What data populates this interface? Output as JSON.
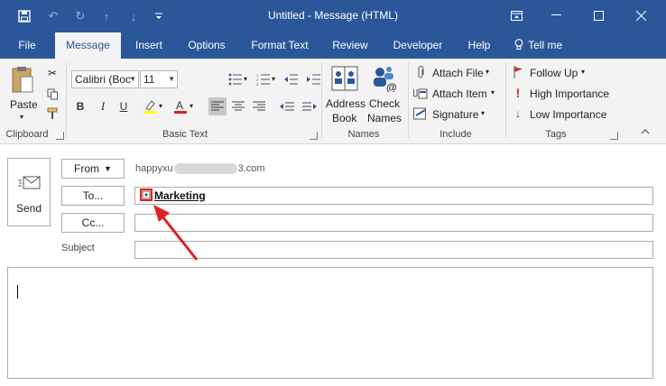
{
  "window": {
    "title": "Untitled  -  Message (HTML)",
    "tell_me": "Tell me"
  },
  "tabs": [
    "File",
    "Message",
    "Insert",
    "Options",
    "Format Text",
    "Review",
    "Developer",
    "Help"
  ],
  "ribbon": {
    "clipboard": {
      "paste": "Paste",
      "label": "Clipboard"
    },
    "basic_text": {
      "font_name": "Calibri (Boc",
      "font_size": "11",
      "label": "Basic Text"
    },
    "names": {
      "address_book": [
        "Address",
        "Book"
      ],
      "check_names": [
        "Check",
        "Names"
      ],
      "label": "Names"
    },
    "include": {
      "attach_file": "Attach File",
      "attach_item": "Attach Item",
      "signature": "Signature",
      "label": "Include"
    },
    "tags": {
      "follow_up": "Follow Up",
      "high_importance": "High Importance",
      "low_importance": "Low Importance",
      "label": "Tags"
    }
  },
  "compose": {
    "send": "Send",
    "from_label": "From",
    "from_address": "happyxu",
    "from_address_end": "3.com",
    "to_label": "To...",
    "to_recipient": "Marketing",
    "cc_label": "Cc...",
    "subject_label": "Subject"
  },
  "colors": {
    "accent": "#2b579a",
    "arrow": "#e02020"
  }
}
